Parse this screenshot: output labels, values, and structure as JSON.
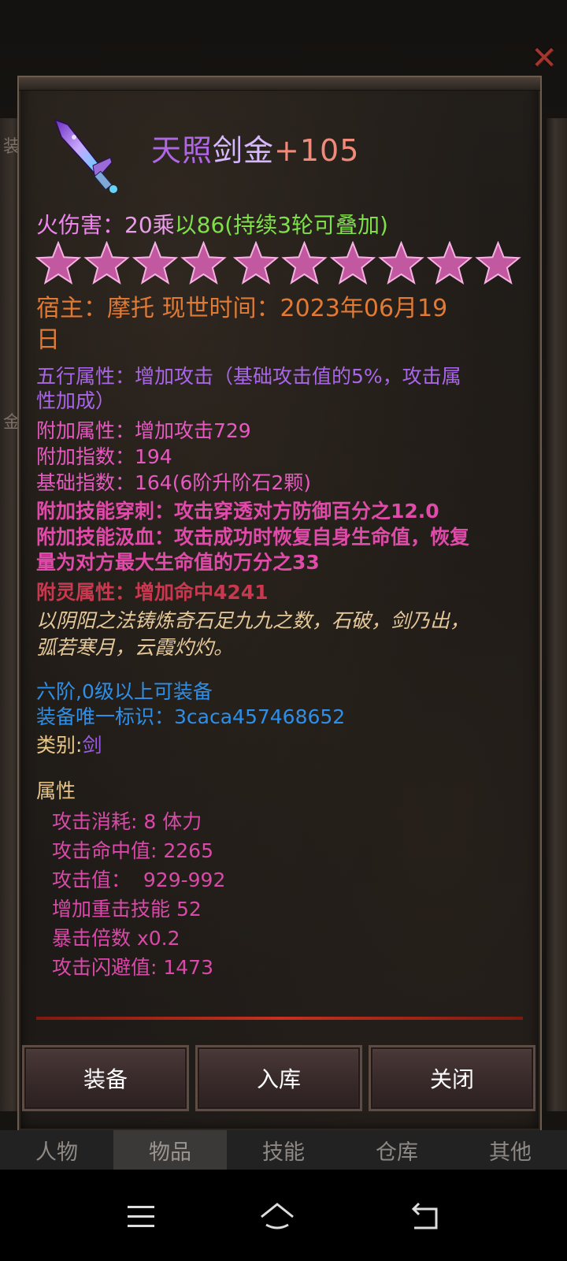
{
  "side_left_chars": [
    "装",
    "金"
  ],
  "item": {
    "title_part1": "天照",
    "title_part2": "剑金",
    "title_part3": "+105",
    "fire_damage_label": "火伤害：",
    "fire_damage_value": "20乘",
    "fire_damage_rest": "以86(持续3轮可叠加)",
    "star_count": 10,
    "owner_line1": "宿主：摩托 现世时间：2023年06月19",
    "owner_line2": "日",
    "five_elements_line1": "五行属性：增加攻击（基础攻击值的5%，攻击属",
    "five_elements_line2": "性加成）",
    "extra_attr": "附加属性：增加攻击729",
    "extra_index": "附加指数：194",
    "base_index": "基础指数：164(6阶升阶石2颗)",
    "skill_pierce": "附加技能穿刺：攻击穿透对方防御百分之12.0",
    "skill_drain_line1": "附加技能汲血：攻击成功时恢复自身生命值，恢复",
    "skill_drain_line2": "量为对方最大生命值的万分之33",
    "spirit_attr": "附灵属性：增加命中4241",
    "description_line1": "以阴阳之法铸炼奇石足九九之数，石破，剑乃出，",
    "description_line2": "弧若寒月，云霞灼灼。",
    "equip_requirement": "六阶,0级以上可装备",
    "unique_id": "装备唯一标识：3caca457468652",
    "category_label": "类别:",
    "category_value": "剑",
    "attributes_heading": "属性",
    "attributes": [
      "攻击消耗: 8 体力",
      "攻击命中值: 2265",
      "攻击值：  929-992",
      "增加重击技能 52",
      "暴击倍数 x0.2",
      "攻击闪避值: 1473"
    ]
  },
  "buttons": {
    "equip": "装备",
    "store": "入库",
    "close": "关闭"
  },
  "tabs": [
    "人物",
    "物品",
    "技能",
    "仓库",
    "其他"
  ],
  "active_tab": "物品",
  "colors": {
    "title_purple": "#b067e6",
    "divider_red": "#c8311f"
  }
}
